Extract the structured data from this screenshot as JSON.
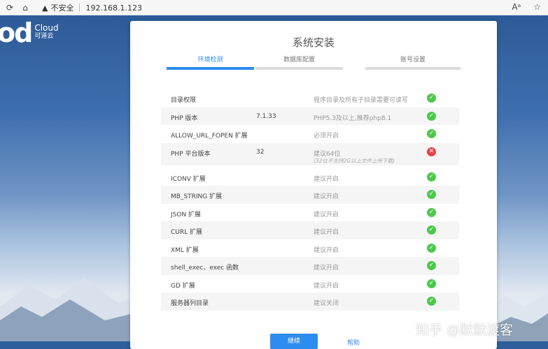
{
  "browser": {
    "security_label": "不安全",
    "url": "192.168.1.123"
  },
  "logo": {
    "mark": "od",
    "line1": "Cloud",
    "line2": "可道云"
  },
  "install": {
    "title": "系统安装",
    "steps": [
      {
        "label": "环境检测",
        "active": true
      },
      {
        "label": "数据库配置",
        "active": false
      },
      {
        "label": "账号设置",
        "active": false
      }
    ],
    "checks": [
      {
        "name": "目录权限",
        "value": "",
        "desc": "程序目录及所有子目录需要可读写",
        "desc2": "",
        "status": "ok"
      },
      {
        "name": "PHP 版本",
        "value": "7.1.33",
        "desc": "PHP5.3及以上,推荐php8.1",
        "desc2": "",
        "status": "ok"
      },
      {
        "name": "ALLOW_URL_FOPEN 扩展",
        "value": "",
        "desc": "必须开启",
        "desc2": "",
        "status": "ok"
      },
      {
        "name": "PHP 平台版本",
        "value": "32",
        "desc": "建议64位",
        "desc2": "(32位不支持2G以上文件上传下载)",
        "status": "fail"
      },
      {
        "name": "ICONV 扩展",
        "value": "",
        "desc": "建议开启",
        "desc2": "",
        "status": "ok"
      },
      {
        "name": "MB_STRING 扩展",
        "value": "",
        "desc": "建议开启",
        "desc2": "",
        "status": "ok"
      },
      {
        "name": "JSON 扩展",
        "value": "",
        "desc": "建议开启",
        "desc2": "",
        "status": "ok"
      },
      {
        "name": "CURL 扩展",
        "value": "",
        "desc": "建议开启",
        "desc2": "",
        "status": "ok"
      },
      {
        "name": "XML 扩展",
        "value": "",
        "desc": "建议开启",
        "desc2": "",
        "status": "ok"
      },
      {
        "name": "shell_exec、exec 函数",
        "value": "",
        "desc": "建议开启",
        "desc2": "",
        "status": "ok"
      },
      {
        "name": "GD 扩展",
        "value": "",
        "desc": "建议开启",
        "desc2": "",
        "status": "ok"
      },
      {
        "name": "服务器列目录",
        "value": "",
        "desc": "建议关闭",
        "desc2": "",
        "status": "ok"
      }
    ],
    "next_label": "继续",
    "help_label": "帮助"
  },
  "watermark": "知乎 @默默渡客",
  "colors": {
    "accent": "#2d8cf0",
    "ok": "#4cc94c",
    "fail": "#e8424a"
  }
}
